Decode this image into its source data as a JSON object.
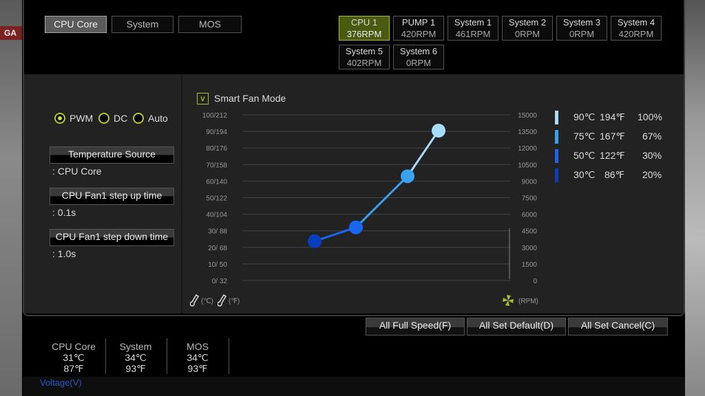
{
  "edge_label": "GA",
  "sources": {
    "tabs": [
      {
        "label": "CPU Core",
        "active": true
      },
      {
        "label": "System"
      },
      {
        "label": "MOS"
      }
    ]
  },
  "fans": [
    {
      "name": "CPU 1",
      "rpm": "376RPM",
      "active": true
    },
    {
      "name": "PUMP 1",
      "rpm": "420RPM"
    },
    {
      "name": "System 1",
      "rpm": "461RPM"
    },
    {
      "name": "System 2",
      "rpm": "0RPM"
    },
    {
      "name": "System 3",
      "rpm": "0RPM"
    },
    {
      "name": "System 4",
      "rpm": "420RPM"
    },
    {
      "name": "System 5",
      "rpm": "402RPM"
    },
    {
      "name": "System 6",
      "rpm": "0RPM"
    }
  ],
  "mode": {
    "options": [
      "PWM",
      "DC",
      "Auto"
    ],
    "selected": "PWM"
  },
  "settings": [
    {
      "label": "Temperature Source",
      "value": ": CPU Core"
    },
    {
      "label": "CPU Fan1 step up time",
      "value": ": 0.1s"
    },
    {
      "label": "CPU Fan1 step down time",
      "value": ": 1.0s"
    }
  ],
  "smart_fan": {
    "label": "Smart Fan Mode",
    "checked": true,
    "check_glyph": "v"
  },
  "chart_data": {
    "type": "line",
    "left_ticks": [
      "0/  32",
      "10/  50",
      "20/  68",
      "30/  88",
      "40/104",
      "50/122",
      "60/140",
      "70/158",
      "80/176",
      "90/194",
      "100/212"
    ],
    "right_ticks": [
      "0",
      "1500",
      "3000",
      "4500",
      "6000",
      "7500",
      "9000",
      "10500",
      "12000",
      "13500",
      "15000"
    ],
    "left_units_c": "(℃)",
    "left_units_f": "(℉)",
    "right_units": "(RPM)",
    "grid": true,
    "points": [
      {
        "temp_c": 30,
        "temp_f": 86,
        "percent": 20,
        "color": "#0a3ec0"
      },
      {
        "temp_c": 50,
        "temp_f": 122,
        "percent": 30,
        "color": "#1a66f0"
      },
      {
        "temp_c": 75,
        "temp_f": 167,
        "percent": 67,
        "color": "#3aa0f0"
      },
      {
        "temp_c": 90,
        "temp_f": 194,
        "percent": 100,
        "color": "#a8dcff"
      }
    ]
  },
  "legend": [
    {
      "c": "90℃",
      "f": "194℉",
      "p": "100%",
      "color": "#a8dcff"
    },
    {
      "c": "75℃",
      "f": "167℉",
      "p": "67%",
      "color": "#3aa0f0"
    },
    {
      "c": "50℃",
      "f": "122℉",
      "p": "30%",
      "color": "#1a66f0"
    },
    {
      "c": "30℃",
      "f": "86℉",
      "p": "20%",
      "color": "#0a3ec0"
    }
  ],
  "actions": {
    "full_speed": "All Full Speed(F)",
    "set_default": "All Set Default(D)",
    "set_cancel": "All Set Cancel(C)"
  },
  "status": [
    {
      "name": "CPU Core",
      "c": "31℃",
      "f": "87℉"
    },
    {
      "name": "System",
      "c": "34℃",
      "f": "93℉"
    },
    {
      "name": "MOS",
      "c": "34℃",
      "f": "93℉"
    }
  ],
  "voltage_label": "Voltage(V)",
  "colors": {
    "accent": "#c8e040",
    "active_fan_bg": "#4a5a10",
    "voltage": "#2a58c8"
  }
}
